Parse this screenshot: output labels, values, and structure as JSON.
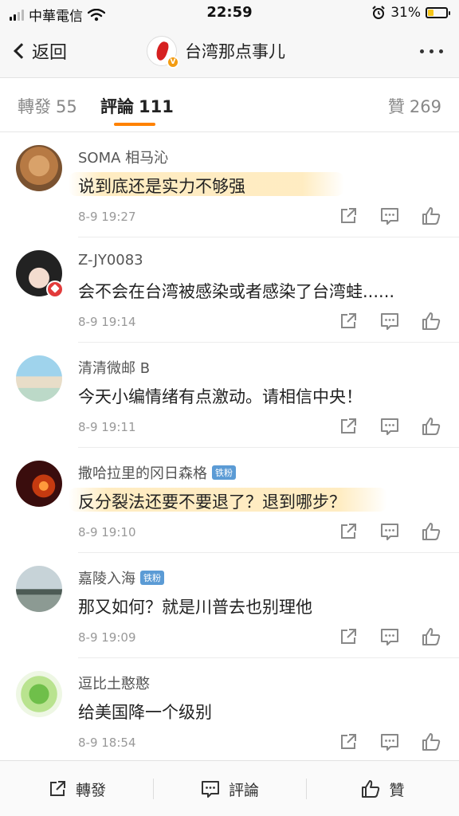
{
  "status_bar": {
    "carrier": "中華電信",
    "time": "22:59",
    "battery": "31%",
    "battery_level": 0.31
  },
  "nav": {
    "back_label": "返回",
    "account_name": "台湾那点事儿",
    "avatar_badge": "V"
  },
  "tabs": {
    "repost_label": "轉發",
    "repost_count": "55",
    "comments_label": "評論",
    "comments_count": "111",
    "likes_label": "贊",
    "likes_count": "269"
  },
  "comments": [
    {
      "name": "SOMA 相马沁",
      "badge": "",
      "text": "说到底还是实力不够强",
      "time": "8-9 19:27"
    },
    {
      "name": "Z-JY0083",
      "badge": "",
      "text": "会不会在台湾被感染或者感染了台湾蛙......",
      "time": "8-9 19:14"
    },
    {
      "name": "清清微邮 B",
      "badge": "",
      "text": "今天小编情绪有点激动。请相信中央！",
      "time": "8-9 19:11"
    },
    {
      "name": "撒哈拉里的冈日森格",
      "badge": "铁粉",
      "text": "反分裂法还要不要退了？退到哪步？",
      "time": "8-9 19:10"
    },
    {
      "name": "嘉陵入海",
      "badge": "铁粉",
      "text": "那又如何？就是川普去也别理他",
      "time": "8-9 19:09"
    },
    {
      "name": "逗比土憨憨",
      "badge": "",
      "text": "给美国降一个级别",
      "time": "8-9 18:54"
    }
  ],
  "bottom_bar": {
    "repost_label": "轉發",
    "comment_label": "評論",
    "like_label": "贊"
  },
  "icons": {
    "action_icons": [
      "share-icon",
      "comment-icon",
      "like-icon"
    ],
    "status_icons": [
      "signal-icon",
      "wifi-icon",
      "alarm-icon",
      "battery-icon"
    ]
  },
  "colors": {
    "accent": "#ff8200",
    "highlight": "#ffd678",
    "fan_badge": "#5b9bd5",
    "verified": "#f39c12"
  }
}
